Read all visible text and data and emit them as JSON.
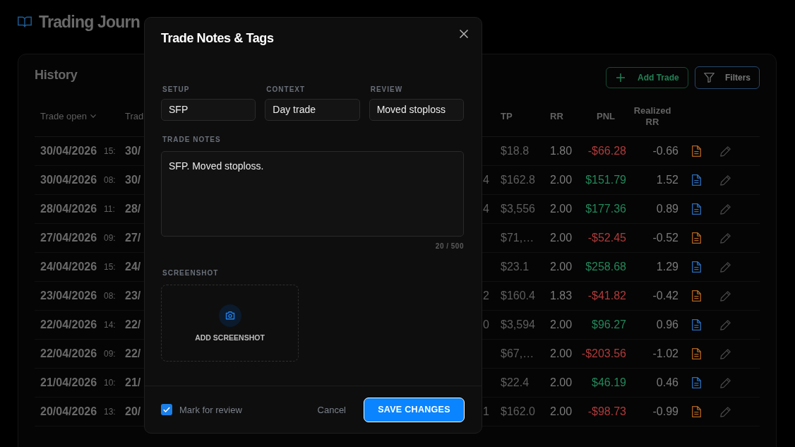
{
  "app": {
    "title": "Trading Journ"
  },
  "history": {
    "title": "History",
    "actions": [
      {
        "kind": "add",
        "label": "Add Trade"
      },
      {
        "kind": "filter",
        "label": "Filters"
      }
    ]
  },
  "table": {
    "columns": [
      {
        "label": "Trade open",
        "sorted": true
      },
      {
        "label": "Trad",
        "sorted": false
      },
      {
        "label": "TP",
        "sorted": false
      },
      {
        "label": "RR",
        "sorted": false
      },
      {
        "label": "PNL",
        "sorted": false
      },
      {
        "label": "Realized RR",
        "sorted": false
      }
    ],
    "rows": [
      {
        "date": "30/04/2026",
        "time": "15:",
        "column_2": "30/",
        "tp": "$18.8",
        "rr": "1.80",
        "pnl": "-$66.28",
        "realized_rr": "-0.66",
        "profit": false
      },
      {
        "date": "30/04/2026",
        "time": "08:",
        "column_2": "30/",
        "column_3": "4",
        "tp": "$162.8",
        "rr": "2.00",
        "pnl": "$151.79",
        "realized_rr": "1.52",
        "profit": true
      },
      {
        "date": "28/04/2026",
        "time": "11:",
        "column_2": "28/",
        "column_3": "4",
        "tp": "$3,556",
        "rr": "2.00",
        "pnl": "$177.36",
        "realized_rr": "0.89",
        "profit": true
      },
      {
        "date": "27/04/2026",
        "time": "09:",
        "column_2": "27/",
        "tp": "$71,…",
        "rr": "2.00",
        "pnl": "-$52.45",
        "realized_rr": "-0.52",
        "profit": false
      },
      {
        "date": "24/04/2026",
        "time": "15:",
        "column_2": "24/",
        "tp": "$23.1",
        "rr": "2.00",
        "pnl": "$258.68",
        "realized_rr": "1.29",
        "profit": true
      },
      {
        "date": "23/04/2026",
        "time": "08:",
        "column_2": "23/",
        "column_3": "2",
        "tp": "$160.4",
        "rr": "1.83",
        "pnl": "-$41.82",
        "realized_rr": "-0.42",
        "profit": false
      },
      {
        "date": "22/04/2026",
        "time": "14:",
        "column_2": "22/",
        "column_3": "0",
        "tp": "$3,594",
        "rr": "2.00",
        "pnl": "$96.27",
        "realized_rr": "0.96",
        "profit": true
      },
      {
        "date": "22/04/2026",
        "time": "09:",
        "column_2": "22/",
        "tp": "$67,…",
        "rr": "2.00",
        "pnl": "-$203.56",
        "realized_rr": "-1.02",
        "profit": false
      },
      {
        "date": "21/04/2026",
        "time": "10:",
        "column_2": "21/",
        "tp": "$22.4",
        "rr": "2.00",
        "pnl": "$46.19",
        "realized_rr": "0.46",
        "profit": true
      },
      {
        "date": "20/04/2026",
        "time": "13:",
        "column_2": "20/",
        "column_3": "1",
        "tp": "$162.0",
        "rr": "2.00",
        "pnl": "-$98.73",
        "realized_rr": "-0.99",
        "profit": false
      }
    ]
  },
  "modal": {
    "title": "Trade Notes & Tags",
    "tags": [
      {
        "label": "SETUP",
        "value": "SFP"
      },
      {
        "label": "CONTEXT",
        "value": "Day trade"
      },
      {
        "label": "REVIEW",
        "value": "Moved stoploss"
      }
    ],
    "notes": {
      "label": "TRADE NOTES",
      "value": "SFP. Moved stoploss.",
      "counter": "20 / 500"
    },
    "screenshot": {
      "label": "SCREENSHOT",
      "action": "ADD SCREENSHOT"
    },
    "mark_for_review": {
      "label": "Mark for review",
      "checked": true
    },
    "buttons": [
      {
        "kind": "secondary",
        "label": "Cancel"
      },
      {
        "kind": "primary",
        "label": "SAVE CHANGES"
      }
    ]
  }
}
